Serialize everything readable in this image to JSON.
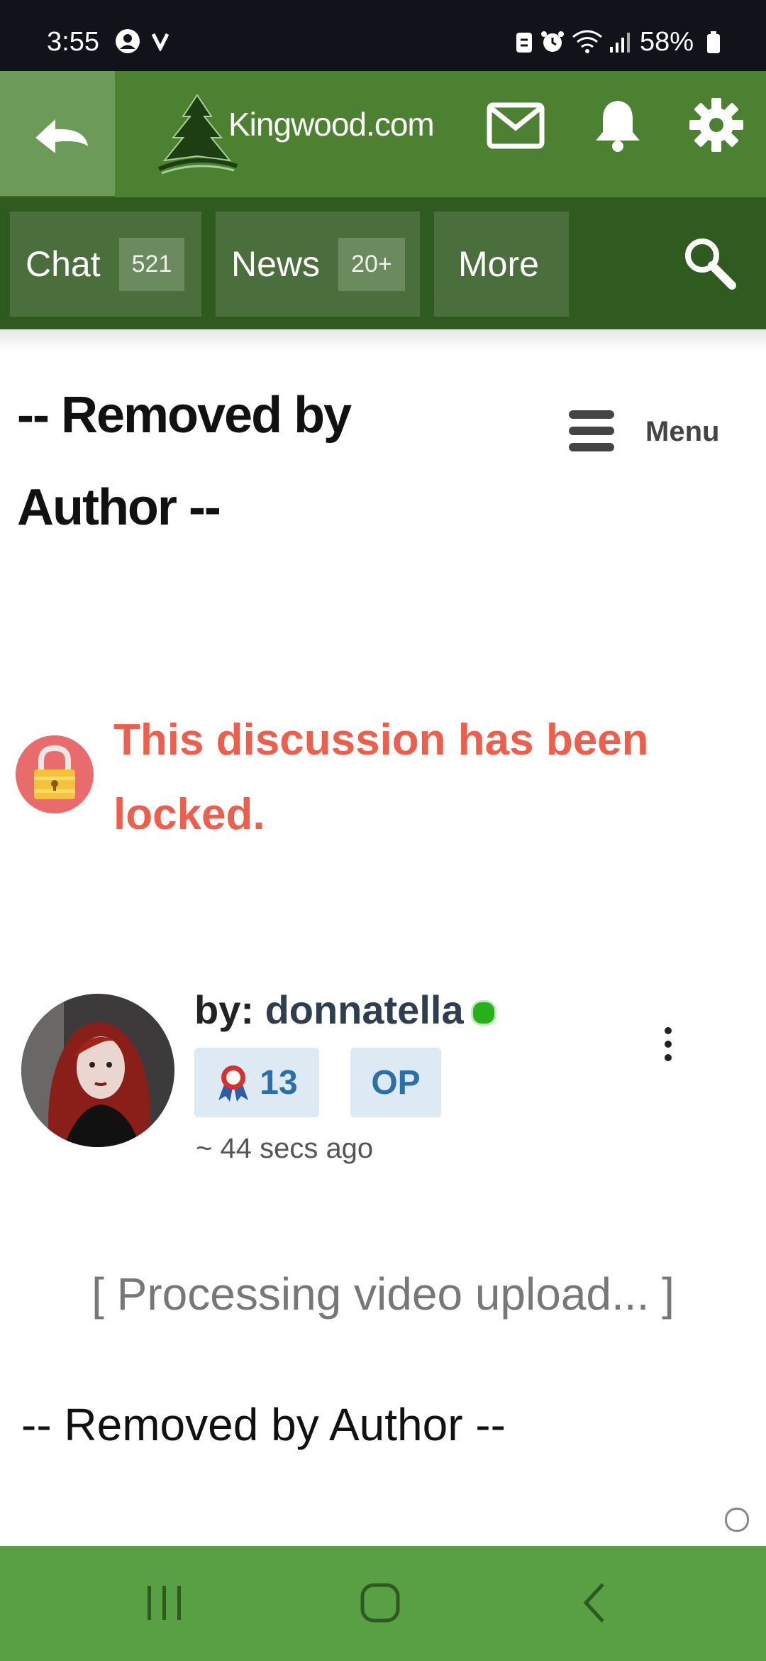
{
  "status_bar": {
    "time": "3:55",
    "battery": "58%",
    "icons": [
      "account-circle-icon",
      "v-icon",
      "sync-icon",
      "alarm-icon",
      "wifi-icon",
      "signal-icon",
      "battery-icon"
    ]
  },
  "header": {
    "logo_text": "Kingwood.com",
    "icons": [
      "back-arrow-icon",
      "mail-icon",
      "bell-icon",
      "gear-icon"
    ]
  },
  "nav": {
    "items": [
      {
        "label": "Chat",
        "badge": "521"
      },
      {
        "label": "News",
        "badge": "20+"
      },
      {
        "label": "More"
      }
    ]
  },
  "page": {
    "title": "-- Removed by Author --",
    "menu_label": "Menu",
    "locked_message": "This discussion has been locked."
  },
  "post": {
    "by_label": "by:",
    "username": "donnatella",
    "badge_count": "13",
    "op_label": "OP",
    "time_ago": "~ 44 secs ago",
    "processing_text": "[ Processing video upload... ]",
    "body": "-- Removed by Author --"
  },
  "colors": {
    "header_green": "#4c8132",
    "nav_dark_green": "#2f5a20",
    "locked_red": "#ef5e4b",
    "bottom_nav_green": "#58a043"
  }
}
